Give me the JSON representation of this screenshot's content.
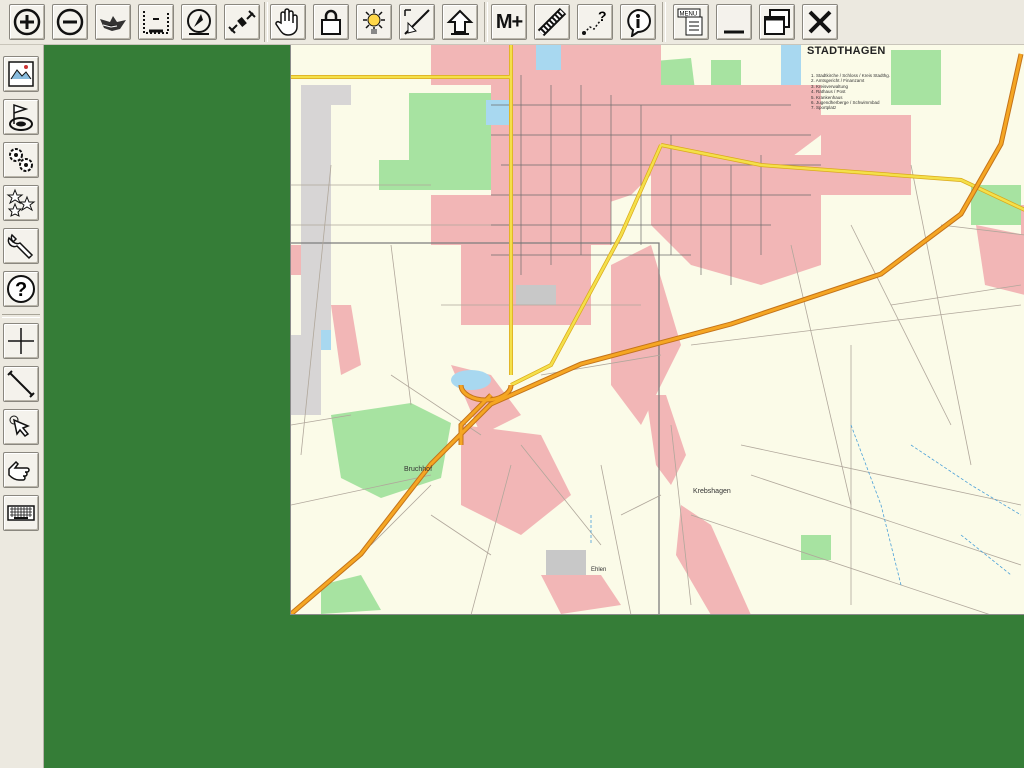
{
  "toolbar": {
    "buttons_group1": [
      {
        "name": "zoom-in-button",
        "icon": "plus-circle-icon"
      },
      {
        "name": "zoom-out-button",
        "icon": "minus-circle-icon"
      },
      {
        "name": "bird-view-button",
        "icon": "eagle-icon"
      },
      {
        "name": "scale-button",
        "icon": "ruler-scale-icon"
      },
      {
        "name": "compass-button",
        "icon": "compass-icon"
      },
      {
        "name": "satellite-button",
        "icon": "satellite-icon"
      },
      {
        "name": "pan-button",
        "icon": "hand-icon"
      },
      {
        "name": "lock-button",
        "icon": "lock-icon"
      },
      {
        "name": "brightness-button",
        "icon": "sun-icon"
      },
      {
        "name": "pen-button",
        "icon": "pen-icon"
      },
      {
        "name": "upload-button",
        "icon": "arrow-up-icon"
      }
    ],
    "memory_label": "M+",
    "menu_label": "MENU"
  },
  "map": {
    "town_label": "STADTHAGEN",
    "place_labels": [
      "Bruchhof",
      "Krebshagen",
      "Ehlen"
    ],
    "legend_lines": [
      "1. Stadtkirche / Schloss / Kreis Stadthg.",
      "2. Amtsgericht / Finanzamt",
      "3. Kreisverwaltung",
      "4. Rathaus / Post",
      "5. Krankenhaus",
      "6. Jugendherberge / Schwimmbad",
      "7. Sportplatz"
    ]
  },
  "colors": {
    "map_background": "#357d37",
    "settlement": "#f2b6b6",
    "forest": "#a7e3a1",
    "main_road": "#f5a623",
    "secondary_road": "#f4e04a"
  }
}
